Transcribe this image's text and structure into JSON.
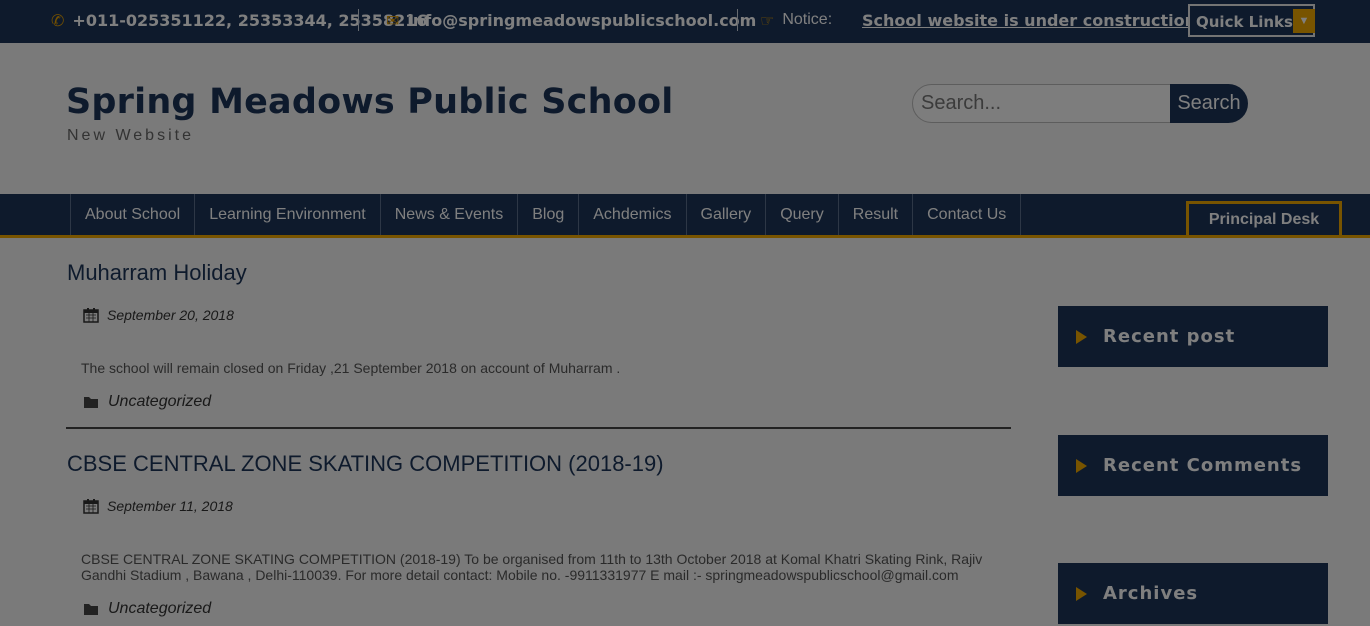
{
  "topbar": {
    "phone": "+011-025351122, 25353344, 25358216",
    "email": "info@springmeadowspublicschool.com",
    "notice_label": "Notice:",
    "notice_text": "School website is under construction",
    "quick_links_label": "Quick Links"
  },
  "header": {
    "title": "Spring Meadows Public School",
    "tagline": "New Website",
    "search_placeholder": "Search...",
    "search_button": "Search"
  },
  "nav": {
    "items": [
      {
        "label": "About School"
      },
      {
        "label": "Learning Environment"
      },
      {
        "label": "News & Events"
      },
      {
        "label": "Blog"
      },
      {
        "label": "Achdemics"
      },
      {
        "label": "Gallery"
      },
      {
        "label": "Query"
      },
      {
        "label": "Result"
      },
      {
        "label": "Contact Us"
      }
    ],
    "principal_desk": "Principal Desk"
  },
  "posts": [
    {
      "title": "Muharram Holiday",
      "date": "September 20, 2018",
      "excerpt": "The school will remain closed on Friday ,21 September 2018 on account of Muharram .",
      "category": "Uncategorized"
    },
    {
      "title": "CBSE CENTRAL ZONE SKATING COMPETITION (2018-19)",
      "date": "September 11, 2018",
      "excerpt": "CBSE CENTRAL ZONE SKATING COMPETITION (2018-19) To be organised from 11th to 13th October 2018 at Komal Khatri Skating Rink, Rajiv Gandhi Stadium , Bawana , Delhi-110039. For more detail contact: Mobile no. -9911331977 E mail :- springmeadowspublicschool@gmail.com",
      "category": "Uncategorized"
    }
  ],
  "sidebar": {
    "widgets": [
      {
        "title": "Recent post"
      },
      {
        "title": "Recent Comments"
      },
      {
        "title": "Archives"
      }
    ]
  },
  "colors": {
    "brand_navy": "#1c3559",
    "accent_gold": "#f0a900",
    "overlay": "rgba(0,0,0,0.5)"
  },
  "icons": [
    "phone-icon",
    "envelope-icon",
    "pointing-hand-icon",
    "caret-down-icon",
    "calendar-icon",
    "folder-icon",
    "triangle-arrow-icon"
  ]
}
